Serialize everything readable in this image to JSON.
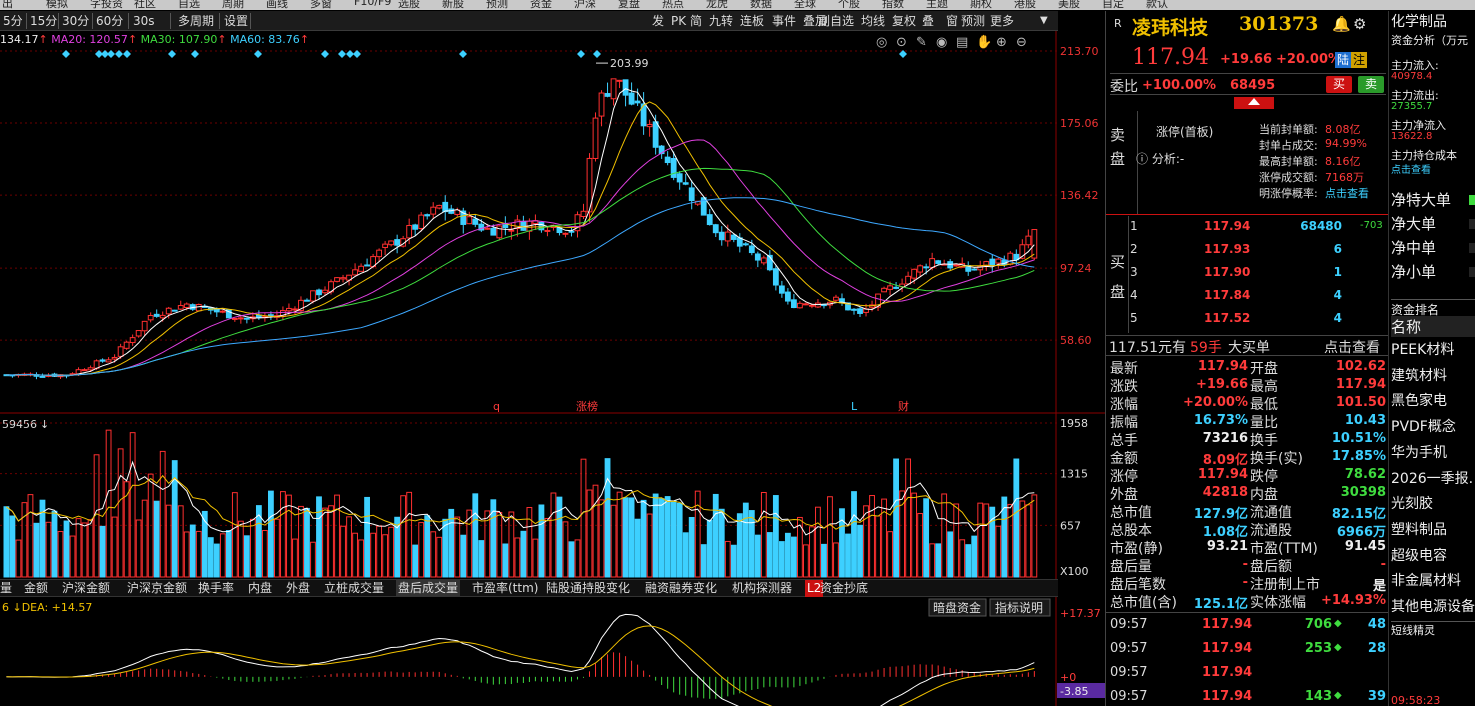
{
  "top_menu": [
    "出",
    "模拟",
    "字投资",
    "社区",
    "自选",
    "周期",
    "画线",
    "多窗",
    "F10/F9",
    "选股",
    "新股",
    "预测",
    "资金",
    "沪深",
    "复盘",
    "热点",
    "龙虎",
    "数据",
    "全球",
    "个股",
    "指数",
    "主题",
    "期权",
    "港股",
    "美股",
    "自定",
    "款认"
  ],
  "toolbar": {
    "periods": [
      "5分",
      "15分",
      "30分",
      "60分",
      "30s",
      "多周期",
      "设置"
    ],
    "right": [
      "发",
      "PK",
      "简",
      "九转",
      "连板",
      "事件",
      "叠加"
    ],
    "right2": [
      "副自选",
      "均线",
      "复权",
      "叠",
      "窗",
      "预测",
      "更多"
    ]
  },
  "ma_legend": {
    "ma10": "134.17",
    "ma20": "MA20: 120.57",
    "ma30": "MA30: 107.90",
    "ma60": "MA60: 83.76"
  },
  "price_axis": [
    "213.70",
    "175.06",
    "136.42",
    "97.24",
    "58.60"
  ],
  "peak_label": "203.99",
  "event_markers": [
    "q",
    "涨榜",
    "L",
    "财"
  ],
  "volume": {
    "header": "59456",
    "axis": [
      "1958",
      "1315",
      "657",
      "X100"
    ]
  },
  "indicator_tabs": [
    "量",
    "金额",
    "沪深金额",
    "沪深京金额",
    "换手率",
    "内盘",
    "外盘",
    "立桩成交量",
    "盘后成交量",
    "市盈率(ttm)",
    "陆股通持股变化",
    "融资融券变化",
    "机构探测器",
    "L2",
    "资金抄底"
  ],
  "macd": {
    "legend": "6 ↓DEA: +14.57",
    "axis": [
      "+17.37",
      "+0",
      "-3.85"
    ],
    "buttons": [
      "暗盘资金",
      "指标说明"
    ]
  },
  "chart_data": {
    "type": "candlestick",
    "price_ylim": [
      40.0,
      213.7
    ],
    "peak": 203.99,
    "volume_ylim": [
      0,
      1958
    ],
    "macd_ylim": [
      -3.85,
      17.37
    ]
  },
  "stock": {
    "name": "凌玮科技",
    "code": "301373",
    "price": "117.94",
    "change": "+19.66",
    "pct": "+20.00%",
    "tag": "陆",
    "tag2": "注",
    "weibi_label": "委比",
    "weibi": "+100.00%",
    "weicha": "68495",
    "buy_btn": "买",
    "sell_btn": "卖",
    "sell_side_label": [
      "卖",
      "盘"
    ],
    "buy_side_label": [
      "买",
      "盘"
    ],
    "limit_title": "涨停(首板)",
    "analysis": "分析:-",
    "limit_info": [
      {
        "k": "当前封单额:",
        "v": "8.08亿"
      },
      {
        "k": "封单占成交:",
        "v": "94.99%"
      },
      {
        "k": "最高封单额:",
        "v": "8.16亿"
      },
      {
        "k": "涨停成交额:",
        "v": "7168万"
      },
      {
        "k": "明涨停概率:",
        "v": "点击查看"
      }
    ],
    "bids": [
      {
        "n": "1",
        "p": "117.94",
        "v": "68480",
        "c": "-703"
      },
      {
        "n": "2",
        "p": "117.93",
        "v": "6",
        "c": ""
      },
      {
        "n": "3",
        "p": "117.90",
        "v": "1",
        "c": ""
      },
      {
        "n": "4",
        "p": "117.84",
        "v": "4",
        "c": ""
      },
      {
        "n": "5",
        "p": "117.52",
        "v": "4",
        "c": ""
      }
    ],
    "big_order": {
      "a": "117.51元有",
      "b": "59手",
      "c": "大买单",
      "d": "点击查看"
    },
    "stats": [
      {
        "k1": "最新",
        "v1": "117.94",
        "k2": "开盘",
        "v2": "102.62"
      },
      {
        "k1": "涨跌",
        "v1": "+19.66",
        "k2": "最高",
        "v2": "117.94"
      },
      {
        "k1": "涨幅",
        "v1": "+20.00%",
        "k2": "最低",
        "v2": "101.50"
      },
      {
        "k1": "振幅",
        "v1": "16.73%",
        "k2": "量比",
        "v2": "10.43"
      },
      {
        "k1": "总手",
        "v1": "73216",
        "k2": "换手",
        "v2": "10.51%"
      },
      {
        "k1": "金额",
        "v1": "8.09亿",
        "k2": "换手(实)",
        "v2": "17.85%"
      },
      {
        "k1": "涨停",
        "v1": "117.94",
        "k2": "跌停",
        "v2": "78.62"
      },
      {
        "k1": "外盘",
        "v1": "42818",
        "k2": "内盘",
        "v2": "30398"
      },
      {
        "k1": "总市值",
        "v1": "127.9亿",
        "k2": "流通值",
        "v2": "82.15亿"
      },
      {
        "k1": "总股本",
        "v1": "1.08亿",
        "k2": "流通股",
        "v2": "6966万"
      },
      {
        "k1": "市盈(静)",
        "v1": "93.21",
        "k2": "市盈(TTM)",
        "v2": "91.45"
      },
      {
        "k1": "盘后量",
        "v1": "-",
        "k2": "盘后额",
        "v2": "-"
      },
      {
        "k1": "盘后笔数",
        "v1": "-",
        "k2": "注册制上市",
        "v2": "是"
      },
      {
        "k1": "总市值(含)",
        "v1": "125.1亿",
        "k2": "实体涨幅",
        "v2": "+14.93%"
      }
    ],
    "ticks": [
      {
        "t": "09:57",
        "p": "117.94",
        "v": "706",
        "n": "48"
      },
      {
        "t": "09:57",
        "p": "117.94",
        "v": "253",
        "n": "28"
      },
      {
        "t": "09:57",
        "p": "117.94",
        "v": "",
        "n": ""
      },
      {
        "t": "09:57",
        "p": "117.94",
        "v": "143",
        "n": "39"
      }
    ]
  },
  "sector": {
    "title": "化学制品",
    "sub": "资金分析（万元",
    "flows": [
      {
        "k": "主力流入:",
        "v": "40978.4"
      },
      {
        "k": "主力流出:",
        "v": "27355.7"
      },
      {
        "k": "主力净流入",
        "v": "13622.8"
      },
      {
        "k": "主力持仓成本",
        "v": "点击查看"
      }
    ],
    "net": [
      "净特大单",
      "净大单",
      "净中单",
      "净小单"
    ],
    "rank_title": "资金排名",
    "rank_header": "名称",
    "ranks": [
      "PEEK材料",
      "建筑材料",
      "黑色家电",
      "PVDF概念",
      "华为手机",
      "2026一季报.",
      "光刻胶",
      "塑料制品",
      "超级电容",
      "非金属材料",
      "其他电源设备"
    ],
    "short_title": "短线精灵",
    "short_time": "09:58:23"
  }
}
